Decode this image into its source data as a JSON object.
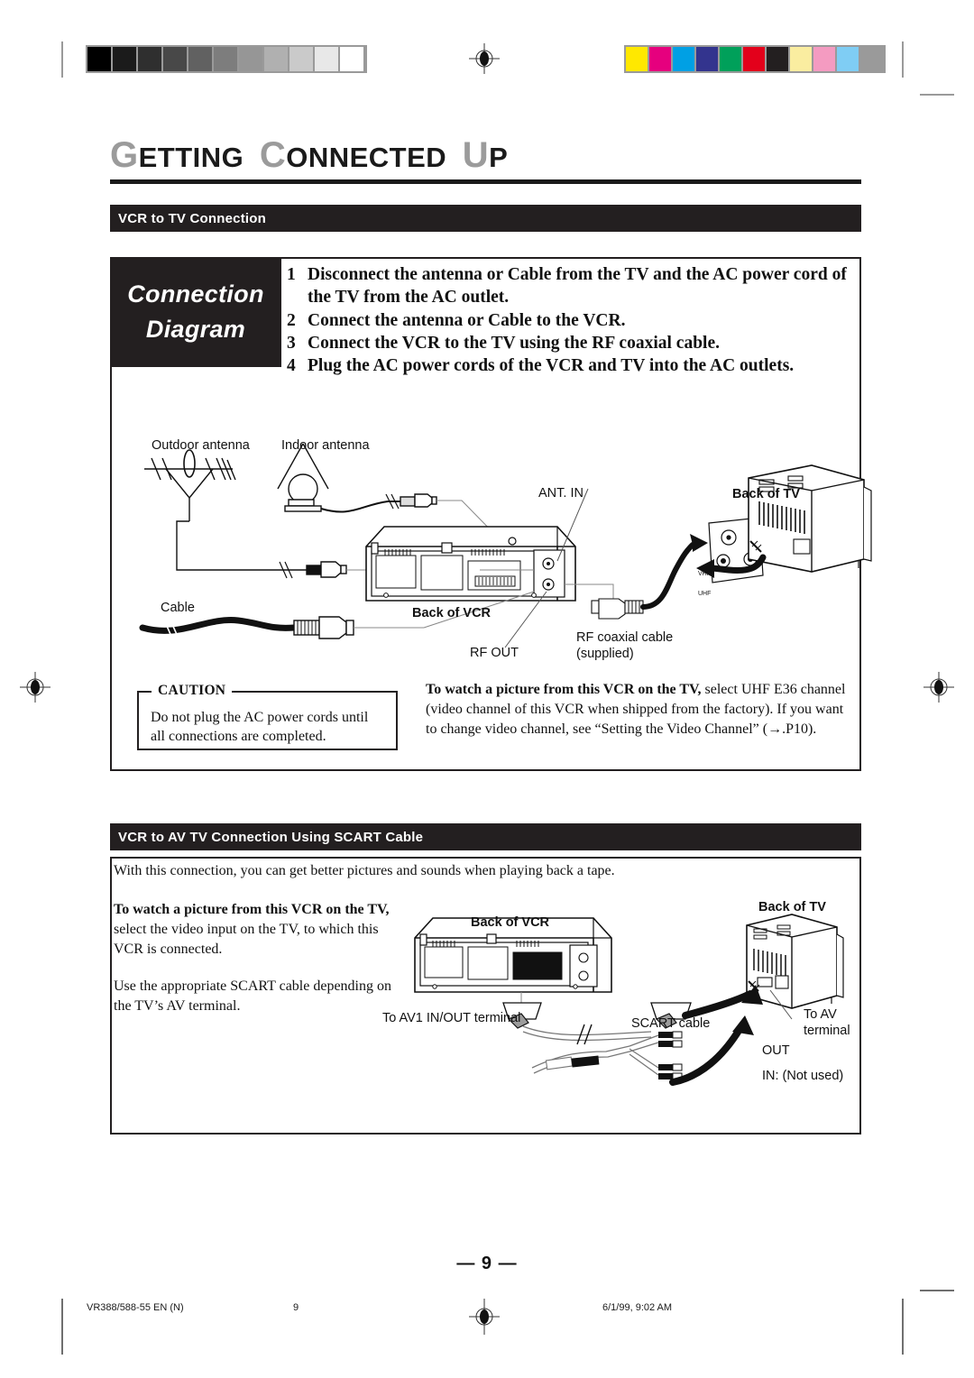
{
  "print_marks": {
    "grayscale_steps": [
      "#000000",
      "#1b1b1b",
      "#2f2f2f",
      "#484848",
      "#616161",
      "#7d7d7d",
      "#969696",
      "#b0b0b0",
      "#cacaca",
      "#e8e8e8",
      "#ffffff"
    ],
    "color_patches": [
      "#ffe800",
      "#e6007e",
      "#00a0e4",
      "#33348e",
      "#00a05a",
      "#e3001b",
      "#231f20",
      "#faeda0",
      "#f49bc1",
      "#7fcdf4",
      "#9a9a9a"
    ],
    "registration_icon": "registration-target-icon"
  },
  "header": {
    "title_parts": [
      {
        "cap": "G",
        "rest": "ETTING"
      },
      {
        "cap": "C",
        "rest": "ONNECTED"
      },
      {
        "cap": "U",
        "rest": "P"
      }
    ],
    "title_plain": "GETTING CONNECTED UP"
  },
  "section1": {
    "bar_label": "VCR to TV Connection",
    "callout_lines": [
      "Connection",
      "Diagram"
    ],
    "steps": [
      {
        "num": "1",
        "text": "Disconnect the antenna or Cable from the TV and the AC power cord of the TV from the AC outlet."
      },
      {
        "num": "2",
        "text": "Connect the antenna or Cable to the VCR."
      },
      {
        "num": "3",
        "text": "Connect the VCR to the TV using the RF coaxial cable."
      },
      {
        "num": "4",
        "text": "Plug the AC power cords of the VCR and TV into the AC outlets."
      }
    ],
    "diagram_labels": {
      "outdoor_antenna": "Outdoor antenna",
      "indoor_antenna": "Indoor antenna",
      "cable": "Cable",
      "back_of_vcr": "Back of VCR",
      "rf_out": "RF OUT",
      "ant_in": "ANT. IN",
      "rf_coaxial_1": "RF coaxial cable",
      "rf_coaxial_2": "(supplied)",
      "back_of_tv": "Back of TV",
      "tv_terminal_vhf": "VHF",
      "tv_terminal_uhf": "UHF"
    },
    "caution": {
      "title": "CAUTION",
      "body": "Do not plug the AC power cords until all connections are completed."
    },
    "note": {
      "lead": "To watch a picture from this VCR on the TV,",
      "rest": " select UHF E36 channel (video channel of this VCR when shipped from the factory). If you want to change video channel, see “Setting the Video Channel” (→.P10)."
    }
  },
  "section2": {
    "bar_label": "VCR to AV TV Connection Using SCART Cable",
    "intro": "With this connection, you can get better pictures and sounds when playing back a tape.",
    "note": {
      "lead": "To watch a picture from this VCR on the TV,",
      "rest": " select the video input on the TV, to which this VCR is connected."
    },
    "note2": "Use the appropriate SCART cable depending on the TV’s AV terminal.",
    "diagram_labels": {
      "back_of_vcr": "Back of VCR",
      "back_of_tv": "Back of TV",
      "av1_terminal": "To AV1 IN/OUT terminal",
      "scart_cable": "SCART cable",
      "to_av_1": "To AV",
      "to_av_2": "terminal",
      "out": "OUT",
      "in_not_used": "IN: (Not used)"
    }
  },
  "footer": {
    "page_number": "— 9 —",
    "doc_code": "VR388/588-55 EN (N)",
    "doc_page": "9",
    "timestamp": "6/1/99, 9:02 AM"
  }
}
